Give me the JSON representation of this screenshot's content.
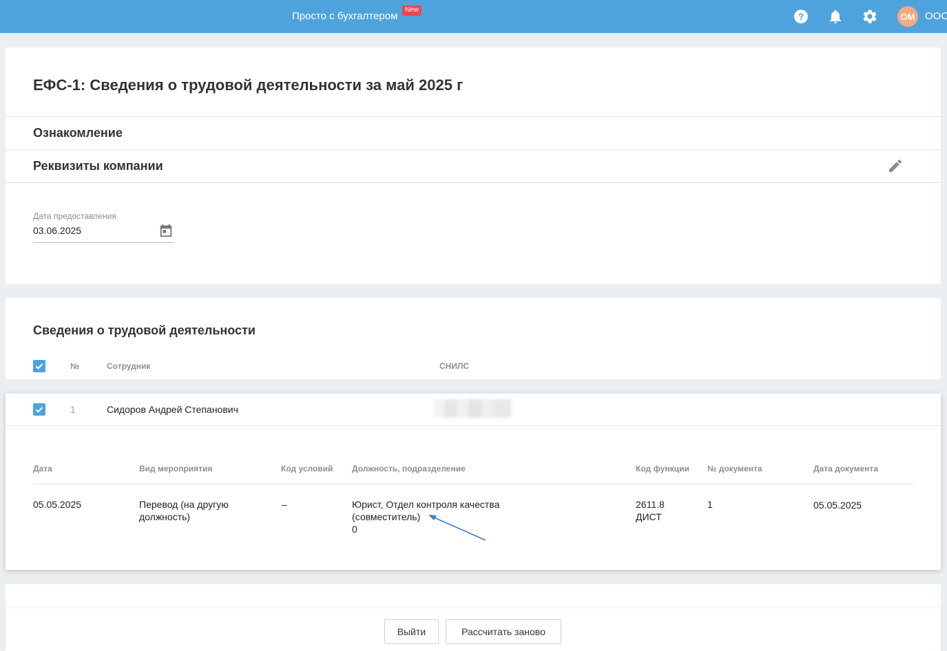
{
  "header": {
    "brand_label": "Просто с бухгалтером",
    "new_badge": "New",
    "avatar_initials": "ОМ",
    "org_name": "ООО",
    "icons": [
      "help-icon",
      "bell-icon",
      "gear-icon"
    ],
    "colors": {
      "accent": "#4fa3dd",
      "badge": "#e8484f",
      "avatar": "#f5a883"
    }
  },
  "form": {
    "title": "ЕФС-1: Сведения о трудовой деятельности за май 2025 г",
    "section_familiarization": "Ознакомление",
    "section_requisites": "Реквизиты компании",
    "submission_date_label": "Дата предоставления",
    "submission_date_value": "03.06.2025"
  },
  "employees": {
    "title": "Сведения о трудовой деятельности",
    "columns": {
      "number": "№",
      "employee": "Сотрудник",
      "snils": "СНИЛС"
    },
    "rows": [
      {
        "number": "1",
        "name": "Сидоров Андрей Степанович",
        "checked": true,
        "events": {
          "columns": [
            "Дата",
            "Вид мероприятия",
            "Код условий",
            "Должность, подразделение",
            "Код функции",
            "№ документа",
            "Дата документа"
          ],
          "items": [
            {
              "date": "05.05.2025",
              "event_type": "Перевод (на другую должность)",
              "conditions_code": "–",
              "position": "Юрист, Отдел контроля качества (совместитель)",
              "position_extra": "0",
              "function_code": "2611.8 ДИСТ",
              "doc_number": "1",
              "doc_date": "05.05.2025"
            }
          ]
        }
      }
    ]
  },
  "footer": {
    "exit_label": "Выйти",
    "recalculate_label": "Рассчитать заново"
  }
}
